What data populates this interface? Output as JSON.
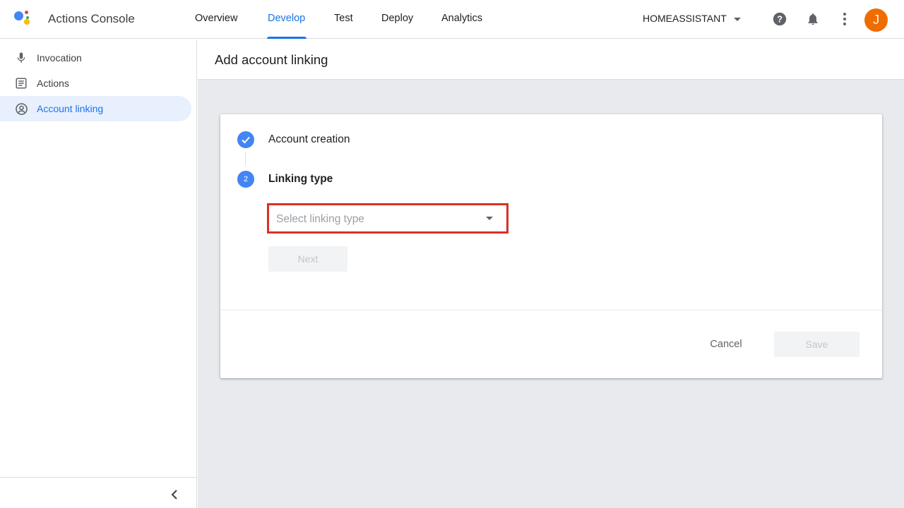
{
  "app": {
    "title": "Actions Console"
  },
  "nav": {
    "tabs": [
      {
        "label": "Overview"
      },
      {
        "label": "Develop",
        "active": true
      },
      {
        "label": "Test"
      },
      {
        "label": "Deploy"
      },
      {
        "label": "Analytics"
      }
    ]
  },
  "project": {
    "name": "HOMEASSISTANT"
  },
  "user": {
    "avatar_initial": "J"
  },
  "icons": {
    "help": "help-icon",
    "notifications": "bell-icon",
    "more": "more-vert-icon",
    "collapse": "chevron-left-icon"
  },
  "sidebar": {
    "items": [
      {
        "label": "Invocation",
        "icon": "mic-icon"
      },
      {
        "label": "Actions",
        "icon": "list-icon"
      },
      {
        "label": "Account linking",
        "icon": "account-circle-icon",
        "active": true
      }
    ]
  },
  "page": {
    "title": "Add account linking"
  },
  "stepper": {
    "steps": [
      {
        "label": "Account creation",
        "status": "done"
      },
      {
        "number": "2",
        "label": "Linking type",
        "status": "current"
      }
    ]
  },
  "form": {
    "select_placeholder": "Select linking type",
    "next_label": "Next"
  },
  "footer": {
    "cancel_label": "Cancel",
    "save_label": "Save"
  },
  "colors": {
    "accent": "#1a73e8",
    "step": "#4285f4",
    "avatar": "#ef6c00",
    "highlight_border": "#d93025",
    "main_bg": "#e8eaed"
  }
}
